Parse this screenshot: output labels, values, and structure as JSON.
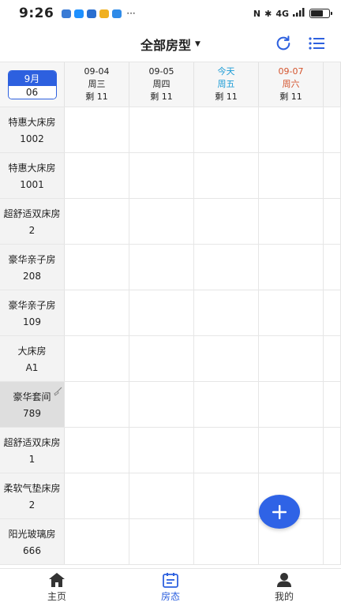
{
  "status_bar": {
    "time": "9:26",
    "more": "···",
    "network": "4G",
    "battery_level": 0.7
  },
  "header": {
    "title": "全部房型"
  },
  "calendar": {
    "month": "9月",
    "day": "06",
    "days": [
      {
        "date": "09-04",
        "weekday": "周三",
        "remaining": "剩 11"
      },
      {
        "date": "09-05",
        "weekday": "周四",
        "remaining": "剩 11"
      },
      {
        "date": "今天",
        "weekday": "周五",
        "remaining": "剩 11"
      },
      {
        "date": "09-07",
        "weekday": "周六",
        "remaining": "剩 11"
      }
    ]
  },
  "rooms": [
    {
      "type": "特惠大床房",
      "number": "1002"
    },
    {
      "type": "特惠大床房",
      "number": "1001"
    },
    {
      "type": "超舒适双床房",
      "number": "2"
    },
    {
      "type": "豪华亲子房",
      "number": "208"
    },
    {
      "type": "豪华亲子房",
      "number": "109"
    },
    {
      "type": "大床房",
      "number": "A1"
    },
    {
      "type": "豪华套间",
      "number": "789"
    },
    {
      "type": "超舒适双床房",
      "number": "1"
    },
    {
      "type": "柔软气垫床房",
      "number": "2"
    },
    {
      "type": "阳光玻璃房",
      "number": "666"
    }
  ],
  "tabbar": {
    "home": "主页",
    "room_status": "房态",
    "mine": "我的"
  },
  "colors": {
    "accent": "#2d60df",
    "today": "#1a9bd5",
    "weekend": "#d4542d"
  }
}
